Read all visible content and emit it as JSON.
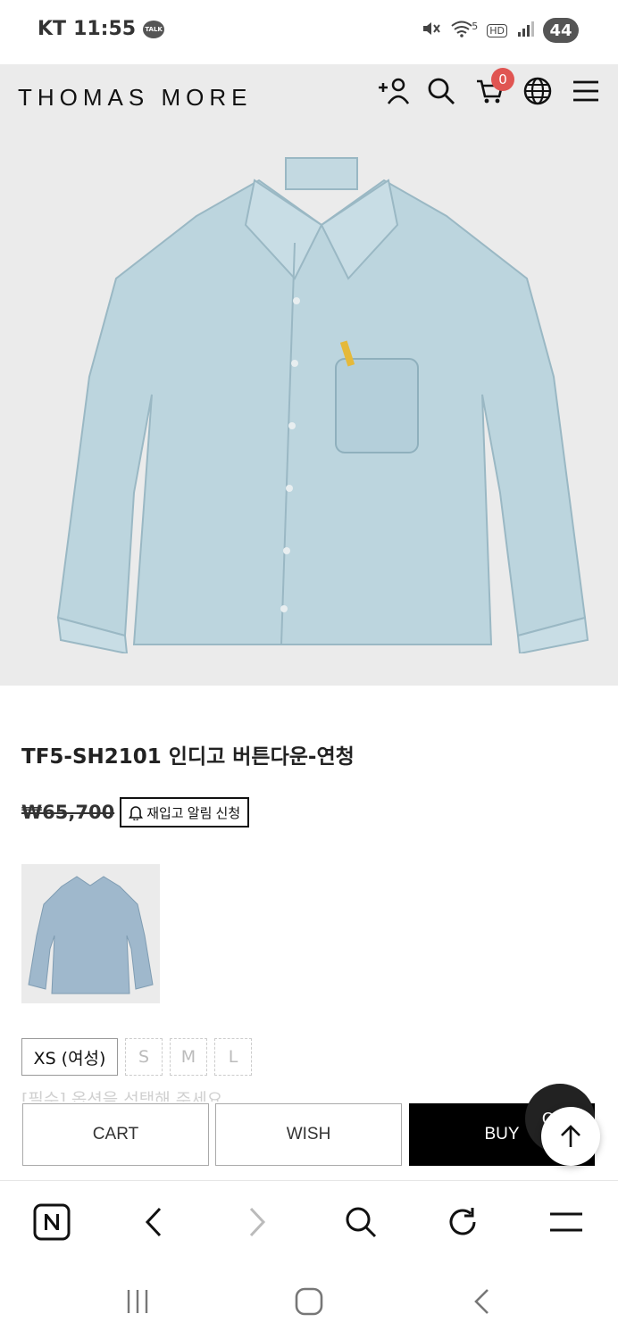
{
  "status_bar": {
    "carrier": "KT",
    "time": "11:55",
    "talk_badge": "TALK",
    "network_label": "5",
    "hd_label": "HD",
    "battery": "44"
  },
  "header": {
    "brand": "THOMAS MORE",
    "cart_count": "0"
  },
  "product": {
    "title": "TF5-SH2101 인디고 버튼다운-연청",
    "price": "₩65,700",
    "restock_label": "재입고 알림 신청"
  },
  "options": {
    "sizes": [
      "XS (여성)",
      "S",
      "M",
      "L"
    ],
    "selected": "XS (여성)",
    "hint": "[필수] 옵션을 선택해 주세요"
  },
  "actions": {
    "cart": "CART",
    "wish": "WISH",
    "buy": "BUY",
    "qa": "Q&A"
  },
  "colors": {
    "accent_badge": "#e05552",
    "buy_bg": "#000000",
    "hero_bg": "#ebebeb",
    "denim": "#b9d3dd"
  }
}
